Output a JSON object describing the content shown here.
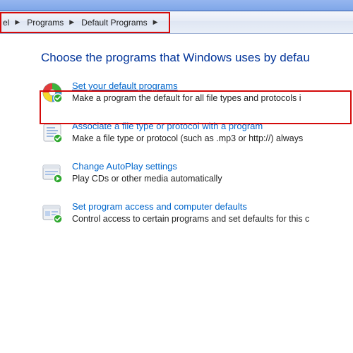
{
  "breadcrumb": {
    "item0": "el",
    "item1": "Programs",
    "item2": "Default Programs"
  },
  "page": {
    "title": "Choose the programs that Windows uses by defau"
  },
  "options": [
    {
      "link": "Set your default programs",
      "desc": "Make a program the default for all file types and protocols i"
    },
    {
      "link": "Associate a file type or protocol with a program",
      "desc": "Make a file type or protocol (such as .mp3 or http://) always"
    },
    {
      "link": "Change AutoPlay settings",
      "desc": "Play CDs or other media automatically"
    },
    {
      "link": "Set program access and computer defaults",
      "desc": "Control access to certain programs and set defaults for this c"
    }
  ],
  "highlight": {
    "addressbar": true,
    "option_index": 0
  }
}
